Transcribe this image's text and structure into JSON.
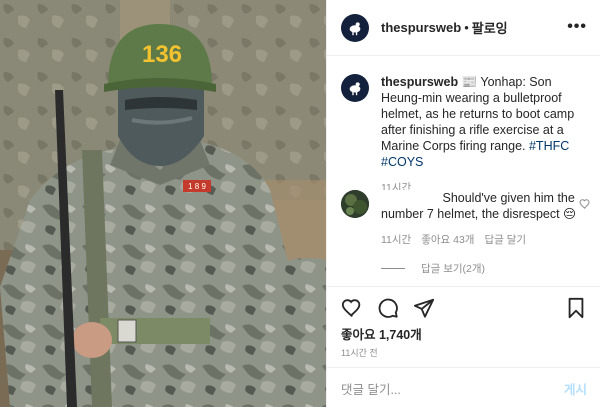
{
  "post": {
    "photo_label": "Soldier in camouflage uniform wearing a green helmet numbered 136",
    "helmet_number": "136",
    "patch_text": "1 8 9"
  },
  "header": {
    "username": "thespursweb",
    "separator": "•",
    "follow_label": "팔로잉",
    "more_label": "•••"
  },
  "caption": {
    "username": "thespursweb",
    "text": " 📰 Yonhap: Son Heung-min wearing a bulletproof helmet, as he returns to boot camp after finishing a rifle exercise at a Marine Corps firing range. ",
    "hashtags": "#THFC #COYS",
    "time": "11시간"
  },
  "comment": {
    "text": "Should've given him the number 7 helmet, the disrespect 😔",
    "time": "11시간",
    "likes": "좋아요 43개",
    "reply_label": "답글 달기",
    "view_replies": "답글 보기(2개)"
  },
  "actions": {
    "likes": "좋아요 1,740개",
    "posted": "11시간 전"
  },
  "add_comment": {
    "placeholder": "댓글 달기...",
    "post_label": "게시"
  },
  "colors": {
    "link": "#00376b",
    "muted": "#8e8e8e",
    "post_button": "#b2dffc",
    "avatar_bg": "#14213d"
  }
}
